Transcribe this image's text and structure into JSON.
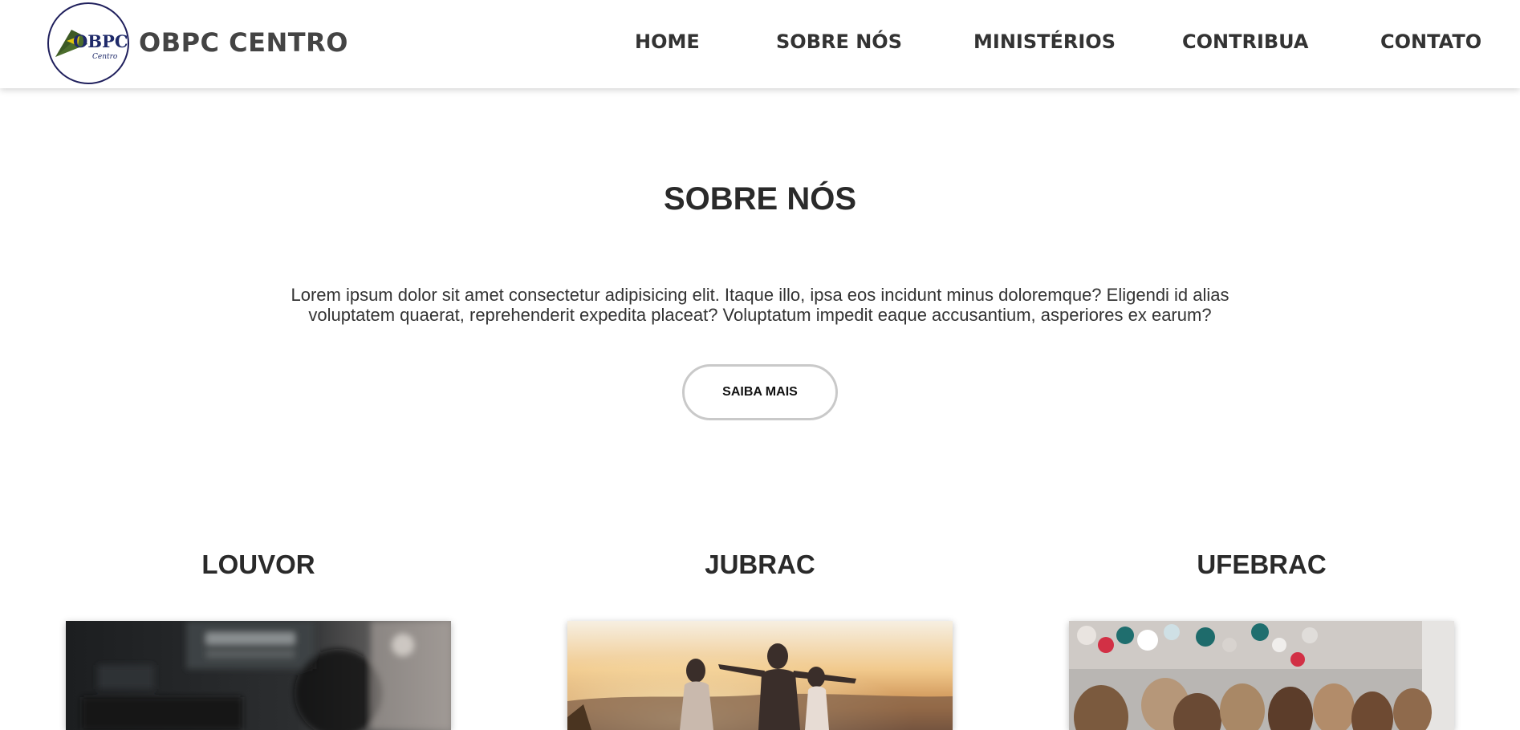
{
  "header": {
    "brand": "OBPC CENTRO",
    "logo_text": "OBPC",
    "logo_subtext": "Centro",
    "nav": [
      "HOME",
      "SOBRE NÓS",
      "MINISTÉRIOS",
      "CONTRIBUA",
      "CONTATO"
    ]
  },
  "about": {
    "title": "SOBRE NÓS",
    "text_line1": "Lorem ipsum dolor sit amet consectetur adipisicing elit. Itaque illo, ipsa eos incidunt minus doloremque? Eligendi id alias",
    "text_line2": "voluptatem quaerat, reprehenderit expedita placeat? Voluptatum impedit eaque accusantium, asperiores ex earum?",
    "button": "SAIBA MAIS"
  },
  "ministries": [
    {
      "title": "LOUVOR"
    },
    {
      "title": "JUBRAC"
    },
    {
      "title": "UFEBRAC"
    }
  ],
  "colors": {
    "logo_border": "#1f1f5c",
    "logo_green": "#3d5a24",
    "logo_yellow": "#e0c410",
    "logo_blue": "#1f2a6a"
  }
}
